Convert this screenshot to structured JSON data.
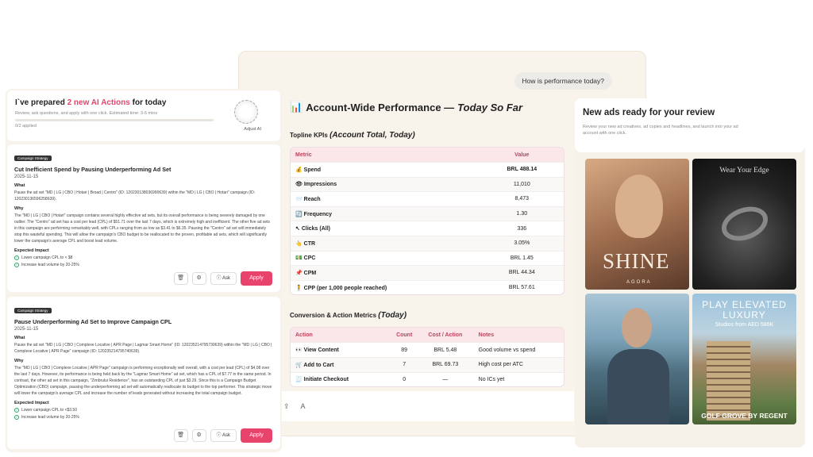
{
  "chat": {
    "user_message": "How is performance today?",
    "report_icon": "📊",
    "report_title": "Account-Wide Performance —",
    "report_title_em": "Today So Far",
    "kpi_section": "Topline KPIs",
    "kpi_section_em": "(Account Total, Today)",
    "kpi_headers": [
      "Metric",
      "Value"
    ],
    "kpis": [
      {
        "icon": "💰",
        "metric": "Spend",
        "value": "BRL 488.14"
      },
      {
        "icon": "👁",
        "metric": "Impressions",
        "value": "11,010"
      },
      {
        "icon": "📨",
        "metric": "Reach",
        "value": "8,473"
      },
      {
        "icon": "🔄",
        "metric": "Frequency",
        "value": "1.30"
      },
      {
        "icon": "↖",
        "metric": "Clicks (All)",
        "value": "336"
      },
      {
        "icon": "👆",
        "metric": "CTR",
        "value": "3.05%"
      },
      {
        "icon": "💵",
        "metric": "CPC",
        "value": "BRL 1.45"
      },
      {
        "icon": "📌",
        "metric": "CPM",
        "value": "BRL 44.34"
      },
      {
        "icon": "🧍",
        "metric": "CPP (per 1,000 people reached)",
        "value": "BRL 57.61"
      }
    ],
    "actions_section": "Conversion & Action Metrics",
    "actions_section_em": "(Today)",
    "action_headers": [
      "Action",
      "Count",
      "Cost / Action",
      "Notes"
    ],
    "actions": [
      {
        "icon": "👀",
        "action": "View Content",
        "count": "89",
        "cost": "BRL 5.48",
        "note": "Good volume vs spend"
      },
      {
        "icon": "🛒",
        "action": "Add to Cart",
        "count": "7",
        "cost": "BRL 69.73",
        "note": "High cost per ATC"
      },
      {
        "icon": "🧾",
        "action": "Initiate Checkout",
        "count": "0",
        "cost": "—",
        "note": "No ICs yet"
      }
    ],
    "composer_placeholder": "A"
  },
  "actions_panel": {
    "title_pre": "I`ve prepared",
    "title_highlight": "2 new AI Actions",
    "title_post": "for today",
    "subtitle": "Review, ask questions, and apply with one click. Estimated time: 3-5 mins",
    "applied": "0/2 applied",
    "adjust_ai": "Adjust AI",
    "cards": [
      {
        "tag": "Campaign Strategy",
        "title": "Cut Inefficient Spend by Pausing Underperforming Ad Set",
        "date": "2025-11-15",
        "what_label": "What",
        "what": "Pause the ad set \"MD | LG | CBO | Hotari | Broad | Centro\" (ID: 120230138036990639) within the \"MD | LG | CBO | Hotari\" campaign (ID: 120230136596258639).",
        "why_label": "Why",
        "why": "The \"MD | LG | CBO | Hotari\" campaign contains several highly effective ad sets, but its overall performance is being severely damaged by one outlier. The \"Centro\" ad set has a cost per lead (CPL) of $51.71 over the last 7 days, which is extremely high and inefficient. The other five ad sets in this campaign are performing remarkably well, with CPLs ranging from as low as $3.41 to $6.35. Pausing the \"Centro\" ad set will immediately stop this wasteful spending. This will allow the campaign's CBO budget to be reallocated to the proven, profitable ad sets, which will significantly lower the campaign's average CPL and boost lead volume.",
        "impact_label": "Expected Impact",
        "impacts": [
          "Lower campaign CPL to < $8",
          "Increase lead volume by 20-25%"
        ],
        "ask": "Ask",
        "apply": "Apply"
      },
      {
        "tag": "Campaign Strategy",
        "title": "Pause Underperforming Ad Set to Improve Campaign CPL",
        "date": "2025-11-15",
        "what_label": "What",
        "what": "Pause the ad set \"MD | LG | CBO | Complexe Locative | APR Page | Lagmar Smart Home\" (ID: 120235214795730639) within the \"MD | LG | CBO | Complexe Locative | APR Page\" campaign (ID: 120235214795740639).",
        "why_label": "Why",
        "why": "The \"MD | LG | CBO | Complexe Locative | APR Page\" campaign is performing exceptionally well overall, with a cost per lead (CPL) of $4.08 over the last 7 days. However, its performance is being held back by the \"Lagmar Smart Home\" ad set, which has a CPL of $7.77 in the same period. In contrast, the other ad set in this campaign, \"Zimbrului Residence\", has an outstanding CPL of just $3.29. Since this is a Campaign Budget Optimization (CBO) campaign, pausing the underperforming ad set will automatically reallocate its budget to the top performer. This strategic move will lower the campaign's average CPL and increase the number of leads generated without increasing the total campaign budget.",
        "impact_label": "Expected Impact",
        "impacts": [
          "Lower campaign CPL to <$3.50",
          "Increase lead volume by 20-25%"
        ],
        "ask": "Ask",
        "apply": "Apply"
      }
    ]
  },
  "ads_panel": {
    "title": "New ads ready for your review",
    "subtitle": "Review your new ad creatives, ad copies and headlines, and launch into your ad account with one click.",
    "ads": [
      {
        "headline": "SHINE",
        "brand": "AGORA"
      },
      {
        "headline": "Wear Your Edge"
      },
      {
        "headline": ""
      },
      {
        "headline": "PLAY ELEVATED LUXURY",
        "sub": "Studios from AED 586K",
        "footer": "GOLF GROVE BY REGENT"
      }
    ]
  }
}
